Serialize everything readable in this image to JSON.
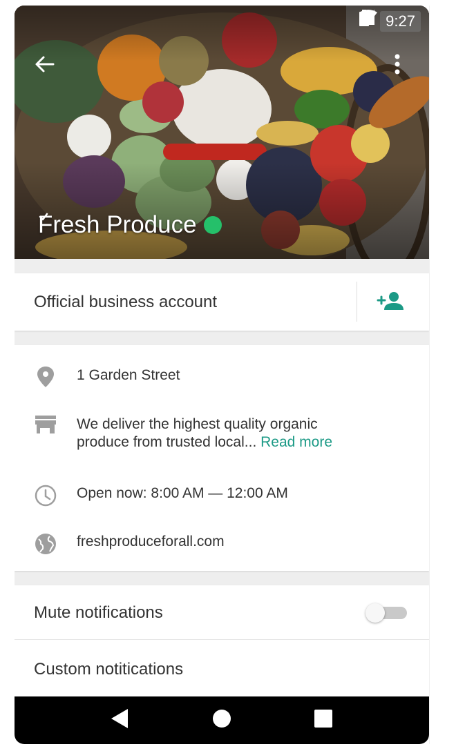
{
  "status_bar": {
    "time": "9:27",
    "icons": [
      "wifi-icon",
      "signal-icon",
      "battery-icon"
    ]
  },
  "header": {
    "title": "Fresh Produce",
    "back_icon": "arrow-back-icon",
    "more_icon": "more-vert-icon",
    "verified_icon": "verified-check-icon"
  },
  "business": {
    "label": "Official business account",
    "add_contact_icon": "person-add-icon"
  },
  "info": {
    "address": "1 Garden Street",
    "description": "We deliver the highest quality organic",
    "description_line2": "produce from trusted local...",
    "read_more": "Read more",
    "hours": "Open now: 8:00 AM — 12:00 AM",
    "website": "freshproduceforall.com",
    "icons": [
      "location-pin-icon",
      "store-icon",
      "clock-icon",
      "globe-icon"
    ]
  },
  "settings": {
    "mute_label": "Mute notifications",
    "mute_enabled": false,
    "custom_label": "Custom notitications"
  },
  "nav": {
    "icons": [
      "back-triangle-icon",
      "home-circle-icon",
      "recents-square-icon"
    ]
  },
  "colors": {
    "accent": "#1c9a86",
    "verified": "#25c06a",
    "text": "#333333",
    "background": "#eeeeee"
  }
}
